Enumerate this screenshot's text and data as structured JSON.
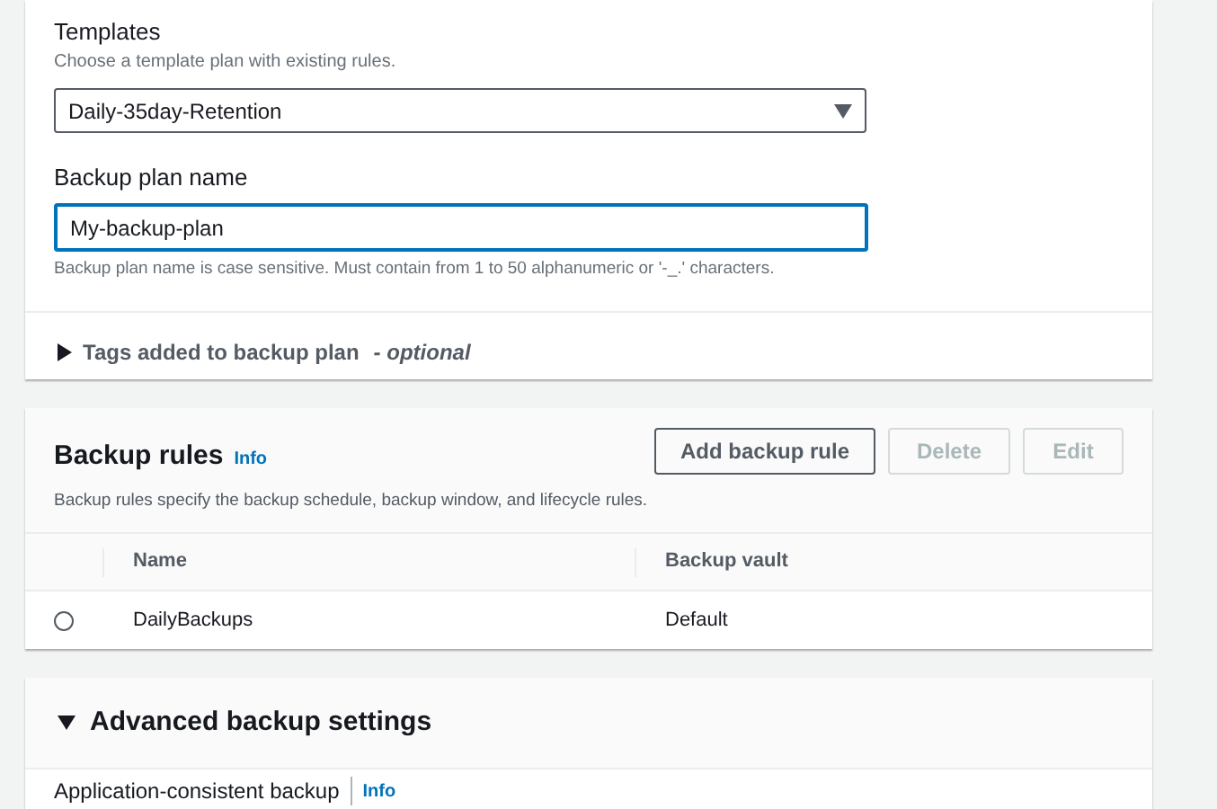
{
  "plan_card": {
    "templates": {
      "label": "Templates",
      "description": "Choose a template plan with existing rules.",
      "value": "Daily-35day-Retention"
    },
    "name_field": {
      "label": "Backup plan name",
      "value": "My-backup-plan",
      "focused": true,
      "hint": "Backup plan name is case sensitive. Must contain from 1 to 50 alphanumeric or '-_.' characters."
    },
    "tags": {
      "label": "Tags added to backup plan",
      "optional": "- optional",
      "expanded": false
    }
  },
  "rules_card": {
    "title": "Backup rules",
    "info": "Info",
    "description": "Backup rules specify the backup schedule, backup window, and lifecycle rules.",
    "buttons": [
      {
        "label": "Add backup rule",
        "disabled": false
      },
      {
        "label": "Delete",
        "disabled": true
      },
      {
        "label": "Edit",
        "disabled": true
      }
    ],
    "table": {
      "columns": [
        "Name",
        "Backup vault"
      ],
      "rows": [
        {
          "cells": [
            "DailyBackups",
            "Default"
          ],
          "selected": false
        }
      ]
    }
  },
  "advanced_card": {
    "title": "Advanced backup settings",
    "expanded": true,
    "field_label": "Application-consistent backup",
    "info": "Info"
  }
}
